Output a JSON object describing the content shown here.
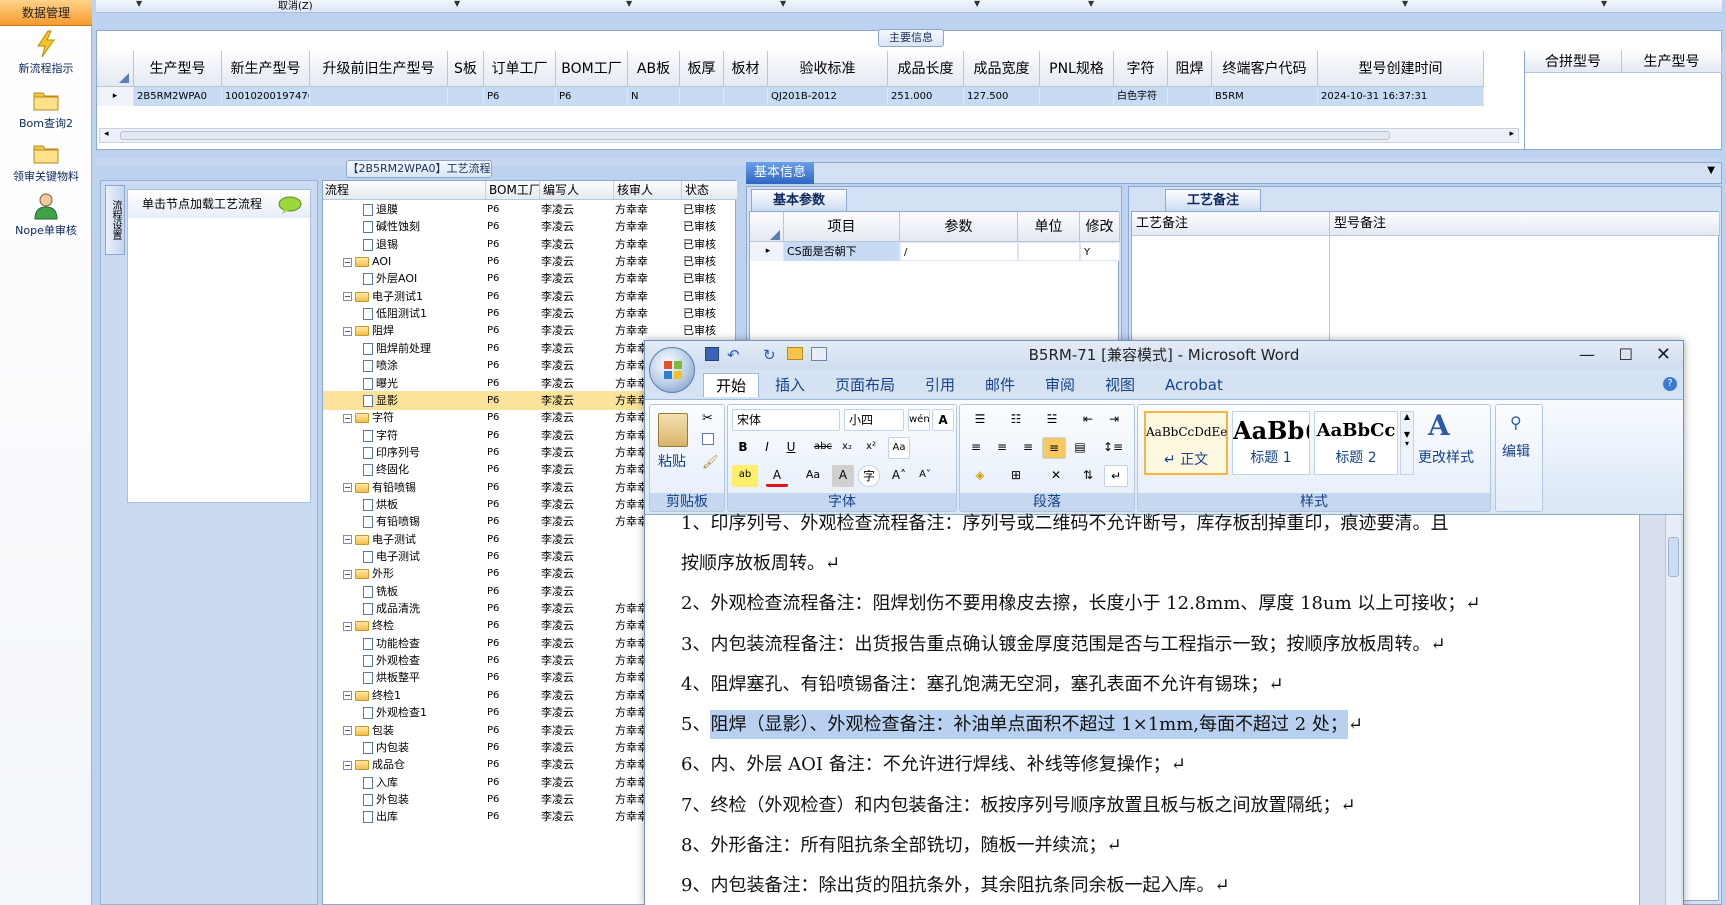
{
  "nav": {
    "header": "数据管理",
    "items": [
      {
        "label": "新流程指示",
        "icon": "lightning-icon"
      },
      {
        "label": "Bom查询2",
        "icon": "folder-icon"
      },
      {
        "label": "领审关键物料",
        "icon": "folder-icon"
      },
      {
        "label": "Nope单审核",
        "icon": "user-icon"
      }
    ]
  },
  "topbar": {
    "cancel_label": "取消(Z)"
  },
  "main_info": {
    "title": "主要信息",
    "columns": [
      "生产型号",
      "新生产型号",
      "升级前旧生产型号",
      "S板",
      "订单工厂",
      "BOM工厂",
      "AB板",
      "板厚",
      "板材",
      "验收标准",
      "成品长度",
      "成品宽度",
      "PNL规格",
      "字符",
      "阻焊",
      "终端客户代码",
      "型号创建时间"
    ],
    "row": [
      "2B5RM2WPA0",
      "10010200197476",
      "",
      "",
      "P6",
      "P6",
      "N",
      "",
      "",
      "QJ201B-2012",
      "251.000",
      "127.500",
      "",
      "白色字符",
      "",
      "B5RM",
      "2024-10-31 16:37:31"
    ],
    "side_columns": [
      "合拼型号",
      "生产型号"
    ]
  },
  "process": {
    "title": "【2B5RM2WPA0】工艺流程",
    "left_hint": "单击节点加载工艺流程",
    "side_tab": "流程设置",
    "columns": [
      "流程",
      "BOM工厂",
      "编写人",
      "核审人",
      "状态"
    ],
    "rows": [
      {
        "name": "退膜",
        "level": 2,
        "type": "doc",
        "bom": "P6",
        "writer": "李凌云",
        "reviewer": "方幸幸",
        "status": "已审核"
      },
      {
        "name": "碱性蚀刻",
        "level": 2,
        "type": "doc",
        "bom": "P6",
        "writer": "李凌云",
        "reviewer": "方幸幸",
        "status": "已审核"
      },
      {
        "name": "退锡",
        "level": 2,
        "type": "doc",
        "bom": "P6",
        "writer": "李凌云",
        "reviewer": "方幸幸",
        "status": "已审核"
      },
      {
        "name": "AOI",
        "level": 1,
        "type": "folder",
        "bom": "P6",
        "writer": "李凌云",
        "reviewer": "方幸幸",
        "status": "已审核"
      },
      {
        "name": "外层AOI",
        "level": 2,
        "type": "doc",
        "bom": "P6",
        "writer": "李凌云",
        "reviewer": "方幸幸",
        "status": "已审核"
      },
      {
        "name": "电子测试1",
        "level": 1,
        "type": "folder",
        "bom": "P6",
        "writer": "李凌云",
        "reviewer": "方幸幸",
        "status": "已审核"
      },
      {
        "name": "低阻测试1",
        "level": 2,
        "type": "doc",
        "bom": "P6",
        "writer": "李凌云",
        "reviewer": "方幸幸",
        "status": "已审核"
      },
      {
        "name": "阻焊",
        "level": 1,
        "type": "folder",
        "bom": "P6",
        "writer": "李凌云",
        "reviewer": "方幸幸",
        "status": "已审核"
      },
      {
        "name": "阻焊前处理",
        "level": 2,
        "type": "doc",
        "bom": "P6",
        "writer": "李凌云",
        "reviewer": "方幸幸",
        "status": ""
      },
      {
        "name": "喷涂",
        "level": 2,
        "type": "doc",
        "bom": "P6",
        "writer": "李凌云",
        "reviewer": "方幸幸",
        "status": ""
      },
      {
        "name": "曝光",
        "level": 2,
        "type": "doc",
        "bom": "P6",
        "writer": "李凌云",
        "reviewer": "方幸幸",
        "status": ""
      },
      {
        "name": "显影",
        "level": 2,
        "type": "doc",
        "bom": "P6",
        "writer": "李凌云",
        "reviewer": "方幸幸",
        "status": "",
        "selected": true
      },
      {
        "name": "字符",
        "level": 1,
        "type": "folder",
        "bom": "P6",
        "writer": "李凌云",
        "reviewer": "方幸幸",
        "status": ""
      },
      {
        "name": "字符",
        "level": 2,
        "type": "doc",
        "bom": "P6",
        "writer": "李凌云",
        "reviewer": "方幸幸",
        "status": ""
      },
      {
        "name": "印序列号",
        "level": 2,
        "type": "doc",
        "bom": "P6",
        "writer": "李凌云",
        "reviewer": "方幸幸",
        "status": ""
      },
      {
        "name": "终固化",
        "level": 2,
        "type": "doc",
        "bom": "P6",
        "writer": "李凌云",
        "reviewer": "方幸幸",
        "status": ""
      },
      {
        "name": "有铅喷锡",
        "level": 1,
        "type": "folder",
        "bom": "P6",
        "writer": "李凌云",
        "reviewer": "方幸幸",
        "status": ""
      },
      {
        "name": "烘板",
        "level": 2,
        "type": "doc",
        "bom": "P6",
        "writer": "李凌云",
        "reviewer": "方幸幸",
        "status": ""
      },
      {
        "name": "有铅喷锡",
        "level": 2,
        "type": "doc",
        "bom": "P6",
        "writer": "李凌云",
        "reviewer": "方幸幸",
        "status": ""
      },
      {
        "name": "电子测试",
        "level": 1,
        "type": "folder",
        "bom": "P6",
        "writer": "李凌云",
        "reviewer": "",
        "status": ""
      },
      {
        "name": "电子测试",
        "level": 2,
        "type": "doc",
        "bom": "P6",
        "writer": "李凌云",
        "reviewer": "",
        "status": ""
      },
      {
        "name": "外形",
        "level": 1,
        "type": "folder",
        "bom": "P6",
        "writer": "李凌云",
        "reviewer": "",
        "status": ""
      },
      {
        "name": "铣板",
        "level": 2,
        "type": "doc",
        "bom": "P6",
        "writer": "李凌云",
        "reviewer": "",
        "status": ""
      },
      {
        "name": "成品清洗",
        "level": 2,
        "type": "doc",
        "bom": "P6",
        "writer": "李凌云",
        "reviewer": "方幸幸",
        "status": ""
      },
      {
        "name": "终检",
        "level": 1,
        "type": "folder",
        "bom": "P6",
        "writer": "李凌云",
        "reviewer": "方幸幸",
        "status": ""
      },
      {
        "name": "功能检查",
        "level": 2,
        "type": "doc",
        "bom": "P6",
        "writer": "李凌云",
        "reviewer": "方幸幸",
        "status": ""
      },
      {
        "name": "外观检查",
        "level": 2,
        "type": "doc",
        "bom": "P6",
        "writer": "李凌云",
        "reviewer": "方幸幸",
        "status": ""
      },
      {
        "name": "烘板整平",
        "level": 2,
        "type": "doc",
        "bom": "P6",
        "writer": "李凌云",
        "reviewer": "方幸幸",
        "status": ""
      },
      {
        "name": "终检1",
        "level": 1,
        "type": "folder",
        "bom": "P6",
        "writer": "李凌云",
        "reviewer": "方幸幸",
        "status": ""
      },
      {
        "name": "外观检查1",
        "level": 2,
        "type": "doc",
        "bom": "P6",
        "writer": "李凌云",
        "reviewer": "方幸幸",
        "status": ""
      },
      {
        "name": "包装",
        "level": 1,
        "type": "folder",
        "bom": "P6",
        "writer": "李凌云",
        "reviewer": "方幸幸",
        "status": ""
      },
      {
        "name": "内包装",
        "level": 2,
        "type": "doc",
        "bom": "P6",
        "writer": "李凌云",
        "reviewer": "方幸幸",
        "status": ""
      },
      {
        "name": "成品仓",
        "level": 1,
        "type": "folder",
        "bom": "P6",
        "writer": "李凌云",
        "reviewer": "方幸幸",
        "status": ""
      },
      {
        "name": "入库",
        "level": 2,
        "type": "doc",
        "bom": "P6",
        "writer": "李凌云",
        "reviewer": "方幸幸",
        "status": ""
      },
      {
        "name": "外包装",
        "level": 2,
        "type": "doc",
        "bom": "P6",
        "writer": "李凌云",
        "reviewer": "方幸幸",
        "status": ""
      },
      {
        "name": "出库",
        "level": 2,
        "type": "doc",
        "bom": "P6",
        "writer": "李凌云",
        "reviewer": "方幸幸",
        "status": ""
      }
    ]
  },
  "basic": {
    "tab": "基本信息",
    "params_tab": "基本参数",
    "params_columns": [
      "项目",
      "参数",
      "单位",
      "修改"
    ],
    "params_row": [
      "CS面是否朝下",
      "/",
      "",
      "Y"
    ],
    "notes_tab": "工艺备注",
    "notes_columns": [
      "工艺备注",
      "型号备注"
    ]
  },
  "word": {
    "title": "B5RM-71 [兼容模式] - Microsoft Word",
    "tabs": [
      "开始",
      "插入",
      "页面布局",
      "引用",
      "邮件",
      "审阅",
      "视图",
      "Acrobat"
    ],
    "font_name": "宋体",
    "font_size": "小四",
    "groups": [
      "剪贴板",
      "字体",
      "段落",
      "样式"
    ],
    "paste_label": "粘贴",
    "change_style_label": "更改样式",
    "edit_label": "编辑",
    "styles": [
      {
        "preview": "AaBbCcDdEe",
        "name": "↵ 正文"
      },
      {
        "preview": "AaBb(",
        "name": "标题 1"
      },
      {
        "preview": "AaBbCc",
        "name": "标题 2"
      }
    ],
    "lines": [
      "1、印序列号、外观检查流程备注：序列号或二维码不允许断号，库存板刮掉重印，痕迹要清。且",
      "按顺序放板周转。↵",
      "2、外观检查流程备注：阻焊划伤不要用橡皮去擦，长度小于 12.8mm、厚度 18um 以上可接收；↵",
      "3、内包装流程备注：出货报告重点确认镀金厚度范围是否与工程指示一致；按顺序放板周转。↵",
      "4、阻焊塞孔、有铅喷锡备注：塞孔饱满无空洞，塞孔表面不允许有锡珠；↵",
      "阻焊（显影）、外观检查备注：补油单点面积不超过 1×1mm,每面不超过 2 处；",
      "6、内、外层 AOI 备注：不允许进行焊线、补线等修复操作；↵",
      "7、终检（外观检查）和内包装备注：板按序列号顺序放置且板与板之间放置隔纸；↵",
      "8、外形备注：所有阻抗条全部铣切，随板一并续流；↵",
      "9、内包装备注：除出货的阻抗条外，其余阻抗条同余板一起入库。↵"
    ],
    "line5_prefix": "5、",
    "line5_end": "↵"
  }
}
